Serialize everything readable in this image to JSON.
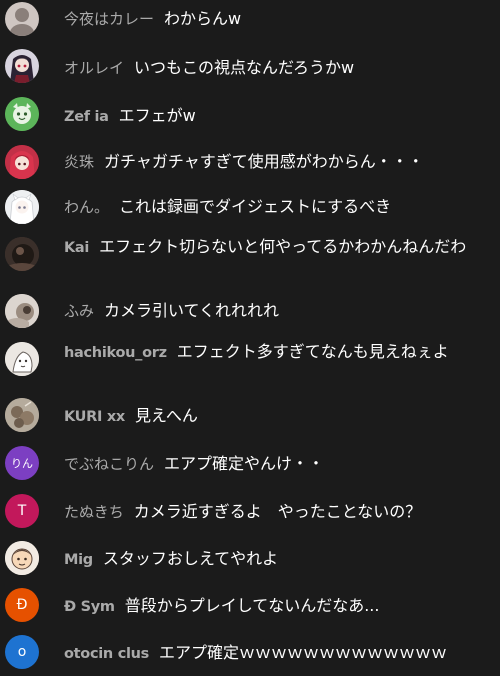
{
  "messages": [
    {
      "author": "今夜はカレー",
      "text": "わからんw",
      "avatar_icon": "default-user-avatar-icon",
      "avatar_color": "#cfc6c2"
    },
    {
      "author": "オルレイ",
      "text": "いつもこの視点なんだろうかw",
      "avatar_icon": "anime-character-avatar-icon",
      "avatar_color": "#d8d4df"
    },
    {
      "author": "Zef ia",
      "text": "エフェがw",
      "avatar_icon": "green-character-avatar-icon",
      "avatar_color": "#55a453"
    },
    {
      "author": "炎珠",
      "text": "ガチャガチャすぎて使用感がわからん・・・",
      "avatar_icon": "red-haired-character-avatar-icon",
      "avatar_color": "#b3283b"
    },
    {
      "author": "わん。",
      "text": "これは録画でダイジェストにするべき",
      "avatar_icon": "white-character-avatar-icon",
      "avatar_color": "#e9ecef"
    },
    {
      "author": "Kai",
      "text": "エフェクト切らないと何やってるかわかんねんだわ",
      "avatar_icon": "dark-photo-avatar-icon",
      "avatar_color": "#4b3c34"
    },
    {
      "author": "ふみ",
      "text": "カメラ引いてくれれれれ",
      "avatar_icon": "photo-avatar-icon",
      "avatar_color": "#d7d1cb"
    },
    {
      "author": "hachikou_orz",
      "text": "エフェクト多すぎてなんも見えねぇよ",
      "avatar_icon": "sketch-avatar-icon",
      "avatar_color": "#e1ddd8"
    },
    {
      "author": "KURI xx",
      "text": "見えへん",
      "avatar_icon": "chestnut-photo-avatar-icon",
      "avatar_color": "#a89e90"
    },
    {
      "author": "でぶねこりん",
      "text": "エアプ確定やんけ・・",
      "avatar_icon": "letter-avatar-icon",
      "avatar_color": "#7c3fc2",
      "avatar_letter": "りん"
    },
    {
      "author": "たぬきち",
      "text": "カメラ近すぎるよ　やったことないの？",
      "avatar_icon": "letter-avatar-icon",
      "avatar_color": "#c2185b",
      "avatar_letter": "T"
    },
    {
      "author": "Mig",
      "text": "スタッフおしえてやれよ",
      "avatar_icon": "cartoon-face-avatar-icon",
      "avatar_color": "#efe6dc"
    },
    {
      "author": "Ð Sym",
      "text": "普段からプレイしてないんだなあ...",
      "avatar_icon": "letter-avatar-icon",
      "avatar_color": "#e65100",
      "avatar_letter": "Đ"
    },
    {
      "author": "otocin clus",
      "text": "エアプ確定ｗｗｗｗｗｗｗｗｗｗｗｗｗ",
      "avatar_icon": "letter-avatar-icon",
      "avatar_color": "#1e73d1",
      "avatar_letter": "o"
    }
  ]
}
